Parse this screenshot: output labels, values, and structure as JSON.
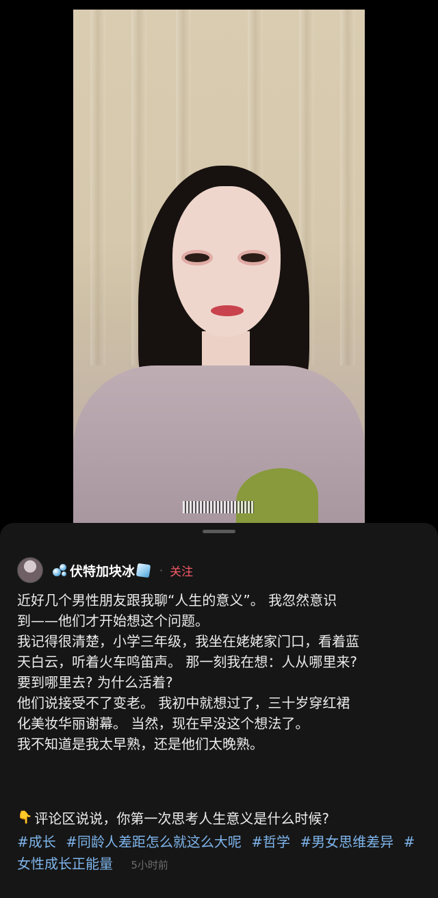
{
  "video": {
    "subtitle_blurred": true
  },
  "author": {
    "name": "伏特加块冰",
    "prefix_icon": "bubbles-icon",
    "suffix_icon": "ice-cube-icon",
    "follow_label": "关注",
    "follow_color": "#f25a66"
  },
  "post": {
    "text": "近好几个男性朋友跟我聊“人生的意义”。 我忽然意识\n到——他们才开始想这个问题。\n我记得很清楚，小学三年级，我坐在姥姥家门口，看着蓝\n天白云，听着火车鸣笛声。 那一刻我在想：人从哪里来?\n要到哪里去? 为什么活着?\n他们说接受不了变老。 我初中就想过了，三十岁穿红裙\n化美妆华丽谢幕。 当然，现在早没这个想法了。\n我不知道是我太早熟，还是他们太晚熟。",
    "cta_icon": "pointing-down-hand-icon",
    "cta": "评论区说说，你第一次思考人生意义是什么时候?",
    "tags": [
      "#成长",
      "#同龄人差距怎么就这么大呢",
      "#哲学",
      "#男女思维差异",
      "#女性成长正能量"
    ],
    "tag_color": "#7fb5ec",
    "time": "5小时前"
  }
}
